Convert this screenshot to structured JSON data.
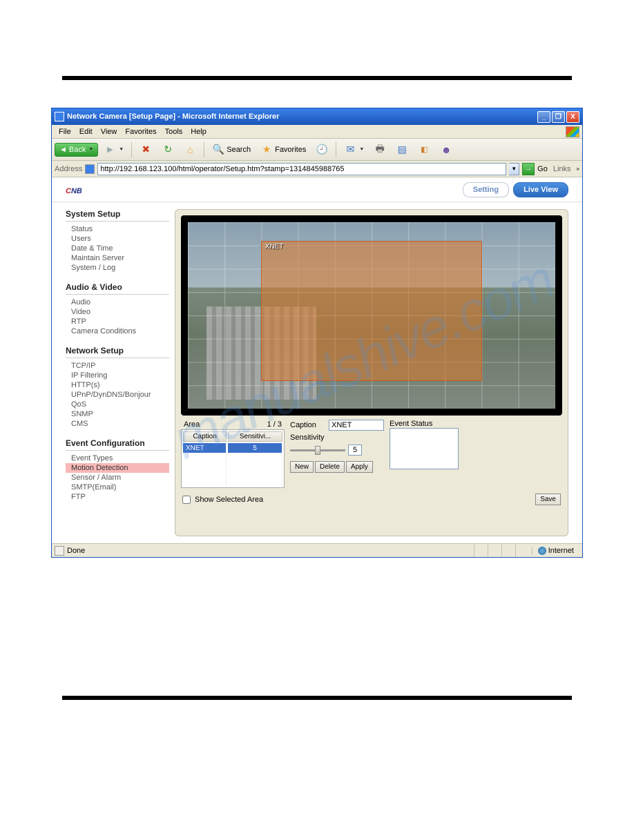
{
  "watermark": "manualshive.com",
  "window": {
    "title": "Network Camera [Setup Page] - Microsoft Internet Explorer",
    "min": "_",
    "max": "❐",
    "close": "X"
  },
  "menu": {
    "file": "File",
    "edit": "Edit",
    "view": "View",
    "favorites": "Favorites",
    "tools": "Tools",
    "help": "Help"
  },
  "toolbar": {
    "back": "Back",
    "search": "Search",
    "favorites": "Favorites"
  },
  "addressbar": {
    "label": "Address",
    "url": "http://192.168.123.100/html/operator/Setup.htm?stamp=1314845988765",
    "go": "Go",
    "links": "Links"
  },
  "header": {
    "logo_c": "C",
    "logo_n": "N",
    "logo_b": "B",
    "setting": "Setting",
    "liveview": "Live View"
  },
  "sidebar": {
    "s1": {
      "title": "System Setup",
      "i0": "Status",
      "i1": "Users",
      "i2": "Date & Time",
      "i3": "Maintain Server",
      "i4": "System / Log"
    },
    "s2": {
      "title": "Audio & Video",
      "i0": "Audio",
      "i1": "Video",
      "i2": "RTP",
      "i3": "Camera Conditions"
    },
    "s3": {
      "title": "Network Setup",
      "i0": "TCP/IP",
      "i1": "IP Filtering",
      "i2": "HTTP(s)",
      "i3": "UPnP/DynDNS/Bonjour",
      "i4": "QoS",
      "i5": "SNMP",
      "i6": "CMS"
    },
    "s4": {
      "title": "Event Configuration",
      "i0": "Event Types",
      "i1": "Motion Detection",
      "i2": "Sensor / Alarm",
      "i3": "SMTP(Email)",
      "i4": "FTP"
    }
  },
  "video": {
    "area_label": "XNET"
  },
  "area_panel": {
    "label": "Area",
    "page": "1 / 3",
    "col_caption": "Caption",
    "col_sens": "Sensitivi...",
    "row_caption": "XNET",
    "row_sens": "5"
  },
  "form": {
    "caption_label": "Caption",
    "caption_value": "XNET",
    "sens_label": "Sensitivity",
    "sens_value": "5",
    "new": "New",
    "delete": "Delete",
    "apply": "Apply",
    "event_status": "Event Status",
    "show_selected": "Show Selected Area",
    "save": "Save"
  },
  "statusbar": {
    "done": "Done",
    "zone": "Internet"
  }
}
